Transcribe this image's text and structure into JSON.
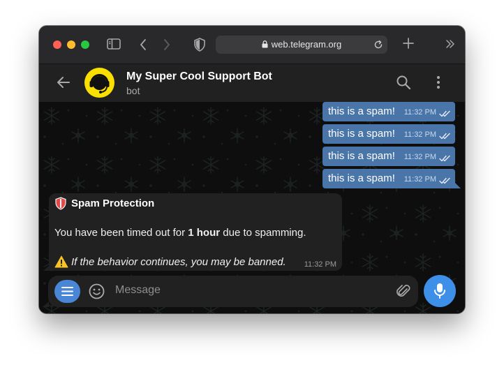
{
  "browser": {
    "url": "web.telegram.org"
  },
  "chat": {
    "title": "My Super Cool Support Bot",
    "status": "bot"
  },
  "messages": {
    "outgoing": [
      {
        "text": "this is a spam!",
        "time": "11:32 PM"
      },
      {
        "text": "this is a spam!",
        "time": "11:32 PM"
      },
      {
        "text": "this is a spam!",
        "time": "11:32 PM"
      },
      {
        "text": "this is a spam!",
        "time": "11:32 PM"
      }
    ],
    "incoming": {
      "title": "Spam Protection",
      "line1_prefix": "You have been timed out for ",
      "line1_bold": "1 hour",
      "line1_suffix": " due to spamming.",
      "warning": "If the behavior continues, you may be banned.",
      "time": "11:32 PM"
    }
  },
  "composer": {
    "placeholder": "Message"
  },
  "icons": {
    "sidebar": "sidebar-icon",
    "back": "chevron-left-icon",
    "forward": "chevron-right-icon",
    "shield": "shield-icon",
    "lock": "lock-icon",
    "reload": "reload-icon",
    "new_tab": "plus-icon",
    "overflow": "double-chevron-icon",
    "chat_back": "arrow-left-icon",
    "search": "search-icon",
    "more": "more-vertical-icon",
    "menu": "menu-icon",
    "emoji": "emoji-icon",
    "attach": "paperclip-icon",
    "mic": "microphone-icon",
    "read_receipt": "double-check-icon",
    "warning": "warning-icon",
    "spam_shield": "red-shield-icon"
  },
  "colors": {
    "outgoing_bubble": "#4a75a9",
    "incoming_bubble": "#212121",
    "accent": "#3e8fe8",
    "avatar_bg": "#f9e000"
  }
}
